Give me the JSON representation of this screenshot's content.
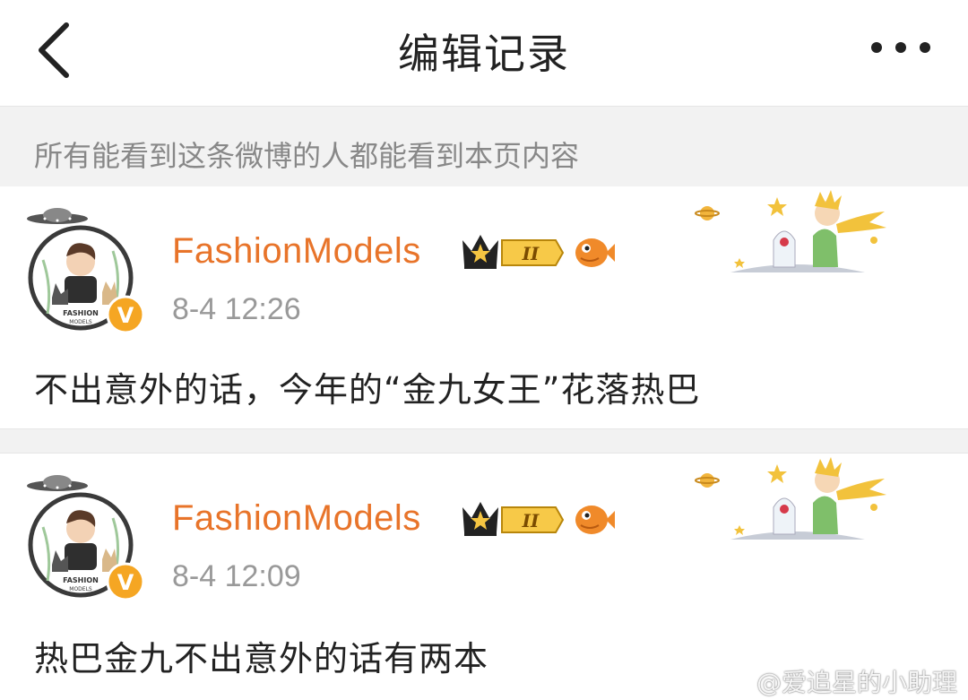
{
  "header": {
    "title": "编辑记录"
  },
  "notice": {
    "text": "所有能看到这条微博的人都能看到本页内容"
  },
  "posts": [
    {
      "username": "FashionModels",
      "timestamp": "8-4 12:26",
      "text": "不出意外的话，今年的“金九女王”花落热巴",
      "level_badge": "II"
    },
    {
      "username": "FashionModels",
      "timestamp": "8-4 12:09",
      "text": "热巴金九不出意外的话有两本",
      "level_badge": "II"
    }
  ],
  "avatar": {
    "text_line1": "FASHION",
    "text_line2": "MODELS",
    "verified_mark": "V"
  },
  "watermark": {
    "text": "@爱追星的小助理"
  },
  "colors": {
    "username": "#e8742a",
    "verified": "#f5a623",
    "notice_bg": "#f2f2f2",
    "timestamp": "#999999"
  }
}
